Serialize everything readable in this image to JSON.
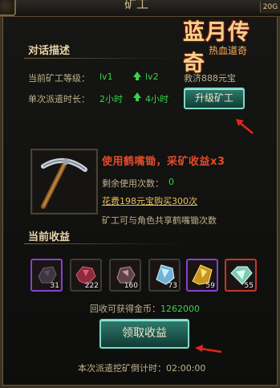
{
  "window": {
    "title": "矿工",
    "top_right_badge": "20G"
  },
  "logo": {
    "main": "蓝月传奇",
    "sub": "热血道奇"
  },
  "dialog": {
    "section_title": "对话描述",
    "miner_level_label": "当前矿工等级：",
    "miner_level_current": "lv1",
    "miner_level_next": "lv2",
    "cost_text": "救济888元宝",
    "dispatch_label": "单次派遣时长：",
    "dispatch_current": "2小时",
    "dispatch_next": "4小时",
    "upgrade_button": "升级矿工"
  },
  "pickaxe": {
    "title": "使用鹤嘴锄，采矿收益x3",
    "remaining_label": "剩余使用次数：",
    "remaining_value": "0",
    "buy_link": "花费198元宝购买300次",
    "share_note": "矿工可与角色共享鹤嘴锄次数"
  },
  "earnings": {
    "section_title": "当前收益",
    "items": [
      {
        "name": "dark-ore",
        "count": "31",
        "border": "#8a3fd0"
      },
      {
        "name": "red-gem",
        "count": "222",
        "border": "#3b3b3b"
      },
      {
        "name": "pink-ore",
        "count": "160",
        "border": "#3b3b3b"
      },
      {
        "name": "blue-crystal",
        "count": "73",
        "border": "#3b3b3b"
      },
      {
        "name": "gold-ore",
        "count": "59",
        "border": "#8a3fd0"
      },
      {
        "name": "green-diamond",
        "count": "55",
        "border": "#c7352a"
      }
    ],
    "recycle_label": "回收可获得金币：",
    "recycle_value": "1262000",
    "claim_button": "领取收益",
    "countdown_label": "本次派遣挖矿倒计时：",
    "countdown_value": "02:00:00"
  }
}
